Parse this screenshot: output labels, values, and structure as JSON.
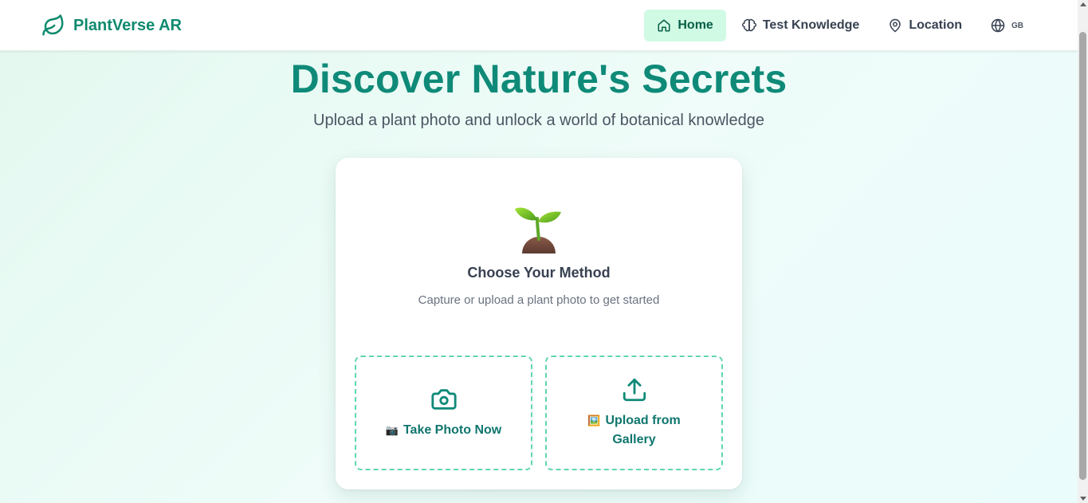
{
  "brand": {
    "name": "PlantVerse AR",
    "icon": "leaf-icon",
    "color": "#0f8a6e"
  },
  "nav": {
    "items": [
      {
        "label": "Home",
        "icon": "home-icon",
        "active": true
      },
      {
        "label": "Test Knowledge",
        "icon": "brain-icon",
        "active": false
      },
      {
        "label": "Location",
        "icon": "map-pin-icon",
        "active": false
      }
    ],
    "language": {
      "code": "GB",
      "icon": "globe-icon"
    }
  },
  "hero": {
    "title": "Discover Nature's Secrets",
    "subtitle": "Upload a plant photo and unlock a world of botanical knowledge"
  },
  "card": {
    "illustration": "seedling-icon",
    "title": "Choose Your Method",
    "subtitle": "Capture or upload a plant photo to get started",
    "methods": [
      {
        "label": "Take Photo Now",
        "emoji": "📷",
        "icon": "camera-icon"
      },
      {
        "label": "Upload from Gallery",
        "emoji": "🖼️",
        "icon": "upload-icon"
      }
    ]
  },
  "colors": {
    "accent": "#0f8a78",
    "active_bg": "#d1fae5",
    "dashed_border": "#5fd6b0"
  }
}
